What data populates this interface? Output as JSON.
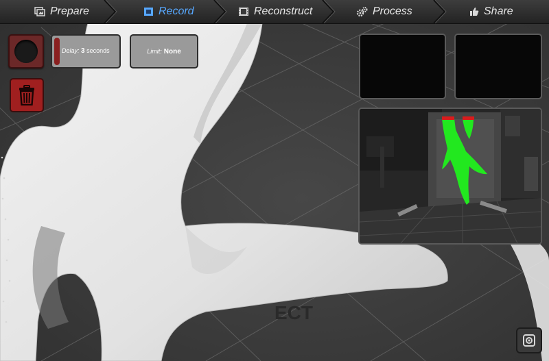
{
  "workflow": {
    "steps": [
      {
        "label": "Prepare",
        "icon": "photo-icon",
        "active": false
      },
      {
        "label": "Record",
        "icon": "record-frame-icon",
        "active": true
      },
      {
        "label": "Reconstruct",
        "icon": "film-icon",
        "active": false
      },
      {
        "label": "Process",
        "icon": "gears-icon",
        "active": false
      },
      {
        "label": "Share",
        "icon": "thumbs-up-icon",
        "active": false
      }
    ]
  },
  "record_controls": {
    "delay_label": "Delay:",
    "delay_value": "3",
    "delay_unit": "seconds",
    "limit_label": "Limit:",
    "limit_value": "None"
  },
  "viewport": {
    "faint_label": "ECT"
  },
  "colors": {
    "active_step": "#57a8ff",
    "record_button": "#6b2828",
    "trash_button": "#a01f1f",
    "mask_green": "#22e81f",
    "mask_red": "#d91c1c"
  }
}
